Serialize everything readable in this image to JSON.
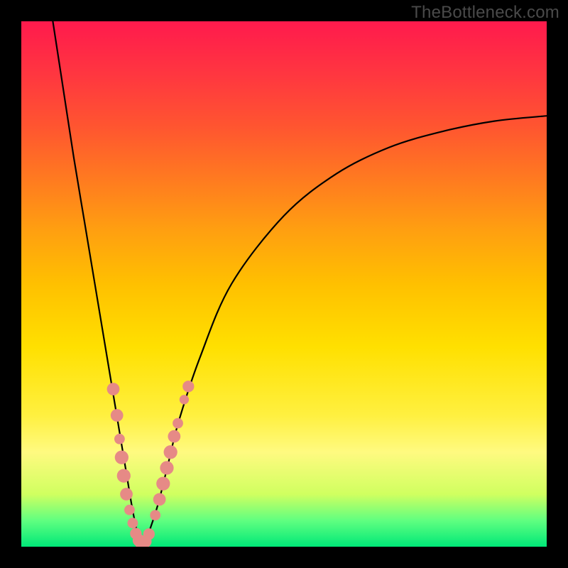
{
  "watermark": "TheBottleneck.com",
  "chart_data": {
    "type": "line",
    "title": "",
    "xlabel": "",
    "ylabel": "",
    "xlim": [
      0,
      100
    ],
    "ylim": [
      0,
      100
    ],
    "grid": false,
    "legend": false,
    "series": [
      {
        "name": "bottleneck-curve",
        "x": [
          6,
          8,
          10,
          12,
          14,
          16,
          18,
          19,
          20,
          21,
          22,
          23,
          24,
          26,
          28,
          30,
          34,
          40,
          50,
          60,
          70,
          80,
          90,
          100
        ],
        "y": [
          100,
          87,
          74,
          62,
          50,
          38,
          26,
          20,
          14,
          8,
          3,
          0,
          2,
          8,
          16,
          24,
          36,
          50,
          63,
          71,
          76,
          79,
          81,
          82
        ],
        "color": "#000000"
      }
    ],
    "markers": [
      {
        "x": 17.5,
        "y": 30,
        "r": 1.2,
        "color": "#e68a86"
      },
      {
        "x": 18.2,
        "y": 25,
        "r": 1.2,
        "color": "#e68a86"
      },
      {
        "x": 18.7,
        "y": 20.5,
        "r": 1.0,
        "color": "#e68a86"
      },
      {
        "x": 19.1,
        "y": 17,
        "r": 1.3,
        "color": "#e68a86"
      },
      {
        "x": 19.5,
        "y": 13.5,
        "r": 1.3,
        "color": "#e68a86"
      },
      {
        "x": 20.0,
        "y": 10,
        "r": 1.2,
        "color": "#e68a86"
      },
      {
        "x": 20.6,
        "y": 7,
        "r": 1.0,
        "color": "#e68a86"
      },
      {
        "x": 21.2,
        "y": 4.5,
        "r": 1.0,
        "color": "#e68a86"
      },
      {
        "x": 21.8,
        "y": 2.5,
        "r": 1.1,
        "color": "#e68a86"
      },
      {
        "x": 22.4,
        "y": 1.2,
        "r": 1.2,
        "color": "#e68a86"
      },
      {
        "x": 23.0,
        "y": 0.6,
        "r": 1.3,
        "color": "#e68a86"
      },
      {
        "x": 23.6,
        "y": 1.0,
        "r": 1.2,
        "color": "#e68a86"
      },
      {
        "x": 24.3,
        "y": 2.4,
        "r": 1.1,
        "color": "#e68a86"
      },
      {
        "x": 25.5,
        "y": 6,
        "r": 1.0,
        "color": "#e68a86"
      },
      {
        "x": 26.3,
        "y": 9,
        "r": 1.2,
        "color": "#e68a86"
      },
      {
        "x": 27.0,
        "y": 12,
        "r": 1.3,
        "color": "#e68a86"
      },
      {
        "x": 27.7,
        "y": 15,
        "r": 1.3,
        "color": "#e68a86"
      },
      {
        "x": 28.4,
        "y": 18,
        "r": 1.3,
        "color": "#e68a86"
      },
      {
        "x": 29.1,
        "y": 21,
        "r": 1.2,
        "color": "#e68a86"
      },
      {
        "x": 29.8,
        "y": 23.5,
        "r": 1.0,
        "color": "#e68a86"
      },
      {
        "x": 31.0,
        "y": 28,
        "r": 0.9,
        "color": "#e68a86"
      },
      {
        "x": 31.8,
        "y": 30.5,
        "r": 1.1,
        "color": "#e68a86"
      }
    ],
    "background_gradient": {
      "top": "#ff1a4d",
      "mid": "#ffe000",
      "bottom": "#00e878"
    }
  }
}
